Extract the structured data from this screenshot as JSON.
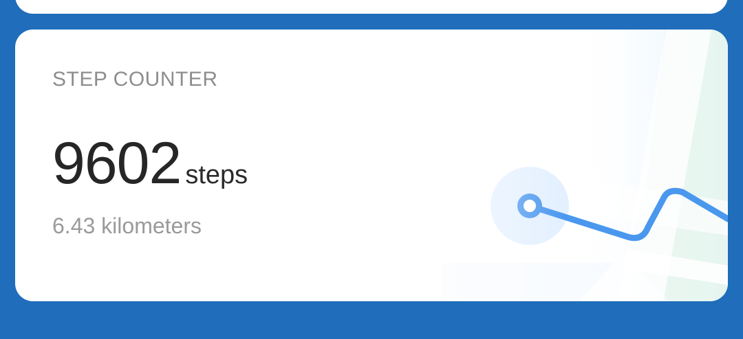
{
  "card": {
    "title": "STEP COUNTER",
    "steps_value": "9602",
    "steps_unit": "steps",
    "distance": "6.43 kilometers"
  },
  "icons": {
    "route": "route-map-icon",
    "location": "location-dot-icon"
  },
  "colors": {
    "background": "#1f6dbb",
    "card": "#ffffff",
    "route_blue": "#4a97ee",
    "map_green": "#e8f6ed",
    "map_blue": "#e6f2ff"
  }
}
